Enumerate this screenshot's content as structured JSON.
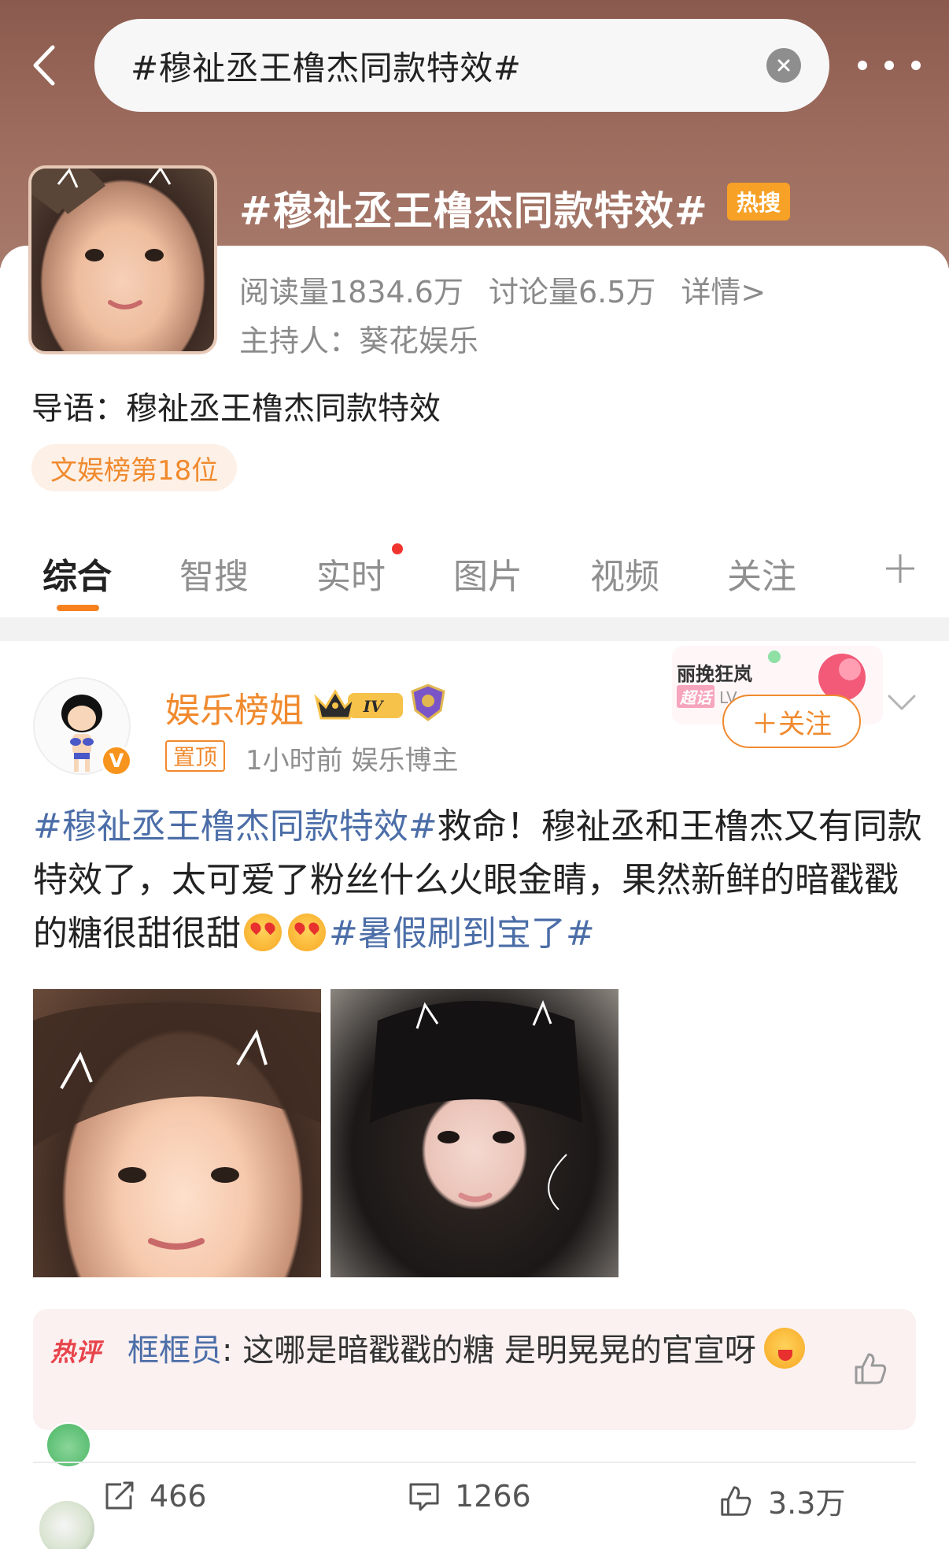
{
  "header": {
    "search_query": "#穆祉丞王橹杰同款特效#"
  },
  "topic": {
    "title": "#穆祉丞王橹杰同款特效#",
    "hot_tag": "热搜",
    "reads": "阅读量1834.6万",
    "discussions": "讨论量6.5万",
    "detail_link": "详情>",
    "host": "主持人：葵花娱乐",
    "guide": "导语：穆祉丞王橹杰同款特效",
    "rank": "文娱榜第18位"
  },
  "tabs": [
    {
      "label": "综合"
    },
    {
      "label": "智搜"
    },
    {
      "label": "实时"
    },
    {
      "label": "图片"
    },
    {
      "label": "视频"
    },
    {
      "label": "关注"
    }
  ],
  "post": {
    "username": "娱乐榜姐",
    "level_badge": "IV",
    "pinned": "置顶",
    "meta": "1小时前  娱乐博主",
    "super_topic_name": "丽挽狂岚",
    "super_topic_tag": "超话",
    "super_topic_level": "LV",
    "follow_label": "＋关注",
    "body": {
      "topic_1": "#穆祉丞王橹杰同款特效#",
      "text": "救命！穆祉丞和王橹杰又有同款特效了，太可爱了粉丝什么火眼金睛，果然新鲜的暗戳戳的糖很甜很甜",
      "topic_2": "#暑假刷到宝了#"
    },
    "hot_comment": {
      "label": "热评",
      "author": "框框员",
      "text": ": 这哪是暗戳戳的糖 是明晃晃的官宣呀"
    },
    "actions": {
      "reposts": "466",
      "comments": "1266",
      "likes": "3.3万"
    }
  },
  "colors": {
    "header_brown": "#9c6a5c",
    "accent_orange": "#f08a2e",
    "link_blue": "#4c6ea8",
    "hot_tag_orange": "#f7a126"
  }
}
